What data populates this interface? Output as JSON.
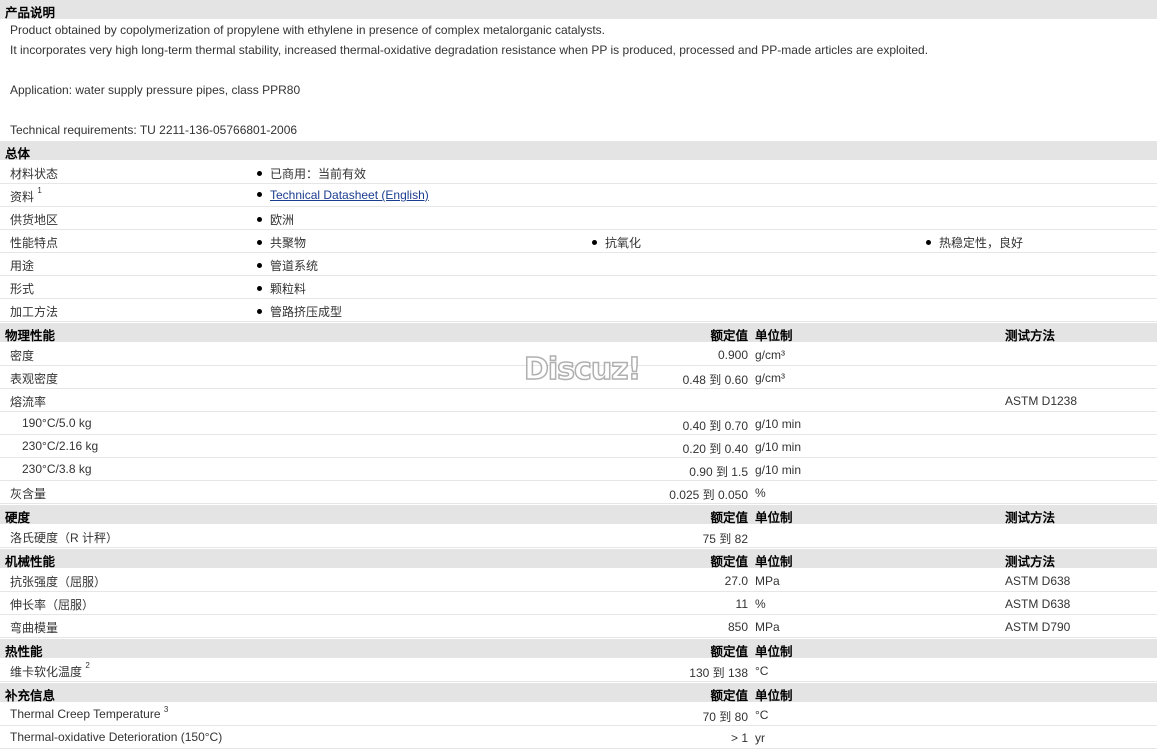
{
  "sections": {
    "description": {
      "title": "产品说明",
      "lines": [
        "Product obtained by copolymerization of propylene with ethylene in presence of complex metalorganic catalysts.",
        "It incorporates very high long-term thermal stability, increased thermal-oxidative degradation resistance when PP is produced, processed and PP-made articles are exploited.",
        "Application: water supply pressure pipes, class PPR80",
        "Technical requirements: TU 2211-136-05766801-2006"
      ]
    },
    "general": {
      "title": "总体",
      "rows": [
        {
          "label": "材料状态",
          "items": [
            "已商用：当前有效"
          ]
        },
        {
          "label": "资料",
          "sup": "1",
          "items": [
            "Technical Datasheet (English)"
          ]
        },
        {
          "label": "供货地区",
          "items": [
            "欧洲"
          ]
        },
        {
          "label": "性能特点",
          "items": [
            "共聚物",
            "抗氧化",
            "热稳定性，良好"
          ]
        },
        {
          "label": "用途",
          "items": [
            "管道系统"
          ]
        },
        {
          "label": "形式",
          "items": [
            "颗粒料"
          ]
        },
        {
          "label": "加工方法",
          "items": [
            "管路挤压成型"
          ]
        }
      ]
    },
    "physical": {
      "title": "物理性能",
      "h_val": "额定值",
      "h_unit": "单位制",
      "h_test": "测试方法",
      "rows": [
        {
          "label": "密度",
          "val": "0.900",
          "unit": "g/cm³",
          "test": ""
        },
        {
          "label": "表观密度",
          "val": "0.48 到  0.60",
          "unit": "g/cm³",
          "test": ""
        },
        {
          "label": "熔流率",
          "val": "",
          "unit": "",
          "test": "ASTM D1238"
        },
        {
          "label": "190°C/5.0 kg",
          "indent": true,
          "val": "0.40 到  0.70",
          "unit": "g/10 min",
          "test": ""
        },
        {
          "label": "230°C/2.16 kg",
          "indent": true,
          "val": "0.20 到  0.40",
          "unit": "g/10 min",
          "test": ""
        },
        {
          "label": "230°C/3.8 kg",
          "indent": true,
          "val": "0.90 到  1.5",
          "unit": "g/10 min",
          "test": ""
        },
        {
          "label": "灰含量",
          "val": "0.025 到  0.050",
          "unit": "%",
          "test": ""
        }
      ]
    },
    "hardness": {
      "title": "硬度",
      "h_val": "额定值",
      "h_unit": "单位制",
      "h_test": "测试方法",
      "rows": [
        {
          "label": "洛氏硬度（R 计秤）",
          "val": "75 到  82",
          "unit": "",
          "test": ""
        }
      ]
    },
    "mechanical": {
      "title": "机械性能",
      "h_val": "额定值",
      "h_unit": "单位制",
      "h_test": "测试方法",
      "rows": [
        {
          "label": "抗张强度（屈服）",
          "val": "27.0",
          "unit": "MPa",
          "test": "ASTM D638"
        },
        {
          "label": "伸长率（屈服）",
          "val": "11",
          "unit": "%",
          "test": "ASTM D638"
        },
        {
          "label": "弯曲模量",
          "val": "850",
          "unit": "MPa",
          "test": "ASTM D790"
        }
      ]
    },
    "thermal": {
      "title": "热性能",
      "h_val": "额定值",
      "h_unit": "单位制",
      "h_test": "",
      "rows": [
        {
          "label": "维卡软化温度",
          "sup": "2",
          "val": "130 到  138",
          "unit": "°C",
          "test": ""
        }
      ]
    },
    "supplemental": {
      "title": "补充信息",
      "h_val": "额定值",
      "h_unit": "单位制",
      "h_test": "",
      "rows": [
        {
          "label": "Thermal Creep Temperature",
          "sup": "3",
          "val": "70 到  80",
          "unit": "°C",
          "test": ""
        },
        {
          "label": "Thermal-oxidative Deterioration (150°C)",
          "val": "> 1",
          "unit": "yr",
          "test": ""
        }
      ]
    }
  },
  "watermark": "Discuz!"
}
